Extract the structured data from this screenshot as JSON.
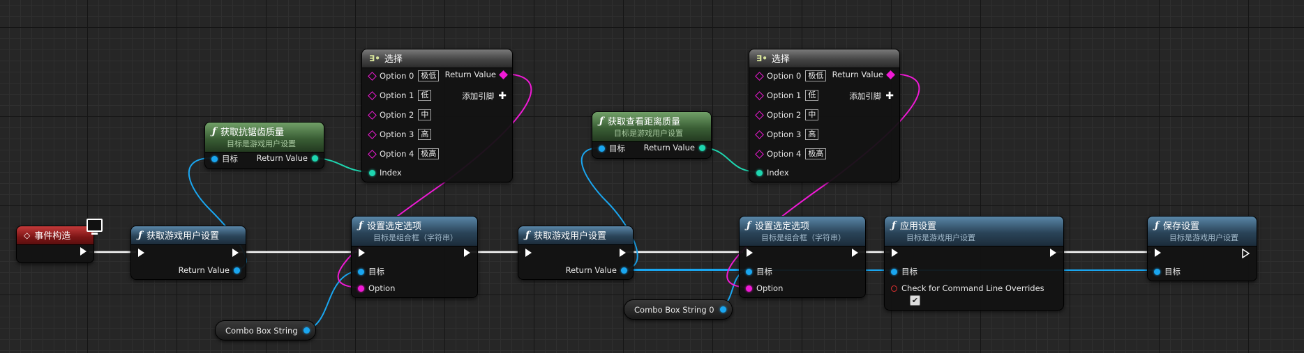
{
  "nodes": {
    "event_construct": {
      "title": "事件构造"
    },
    "get_user_settings_1": {
      "title": "获取游戏用户设置",
      "return_label": "Return Value"
    },
    "get_aa_quality": {
      "title": "获取抗锯齿质量",
      "subtitle": "目标是游戏用户设置",
      "target_label": "目标",
      "return_label": "Return Value"
    },
    "select_1": {
      "title": "选择",
      "options": [
        {
          "label": "Option 0",
          "value": "极低"
        },
        {
          "label": "Option 1",
          "value": "低"
        },
        {
          "label": "Option 2",
          "value": "中"
        },
        {
          "label": "Option 3",
          "value": "高"
        },
        {
          "label": "Option 4",
          "value": "极高"
        }
      ],
      "return_label": "Return Value",
      "add_pin_label": "添加引脚",
      "index_label": "Index"
    },
    "set_selected_option_1": {
      "title": "设置选定选项",
      "subtitle": "目标是组合框（字符串）",
      "target_label": "目标",
      "option_label": "Option"
    },
    "combo_box_1": {
      "label": "Combo Box String"
    },
    "get_user_settings_2": {
      "title": "获取游戏用户设置",
      "return_label": "Return Value"
    },
    "get_view_distance": {
      "title": "获取查看距离质量",
      "subtitle": "目标是游戏用户设置",
      "target_label": "目标",
      "return_label": "Return Value"
    },
    "select_2": {
      "title": "选择",
      "options": [
        {
          "label": "Option 0",
          "value": "极低"
        },
        {
          "label": "Option 1",
          "value": "低"
        },
        {
          "label": "Option 2",
          "value": "中"
        },
        {
          "label": "Option 3",
          "value": "高"
        },
        {
          "label": "Option 4",
          "value": "极高"
        }
      ],
      "return_label": "Return Value",
      "add_pin_label": "添加引脚",
      "index_label": "Index"
    },
    "set_selected_option_2": {
      "title": "设置选定选项",
      "subtitle": "目标是组合框（字符串）",
      "target_label": "目标",
      "option_label": "Option"
    },
    "combo_box_2": {
      "label": "Combo Box String 0"
    },
    "apply_settings": {
      "title": "应用设置",
      "subtitle": "目标是游戏用户设置",
      "target_label": "目标",
      "check_label": "Check for Command Line Overrides",
      "check_value": "✔"
    },
    "save_settings": {
      "title": "保存设置",
      "subtitle": "目标是游戏用户设置",
      "target_label": "目标"
    }
  },
  "icons": {
    "function": "ƒ",
    "select": "∃•",
    "event": "◇"
  },
  "colors": {
    "exec": "#ffffff",
    "object": "#1aa6f0",
    "byte": "#1ed6b0",
    "string": "#f01ad6",
    "bool": "#e03030"
  }
}
